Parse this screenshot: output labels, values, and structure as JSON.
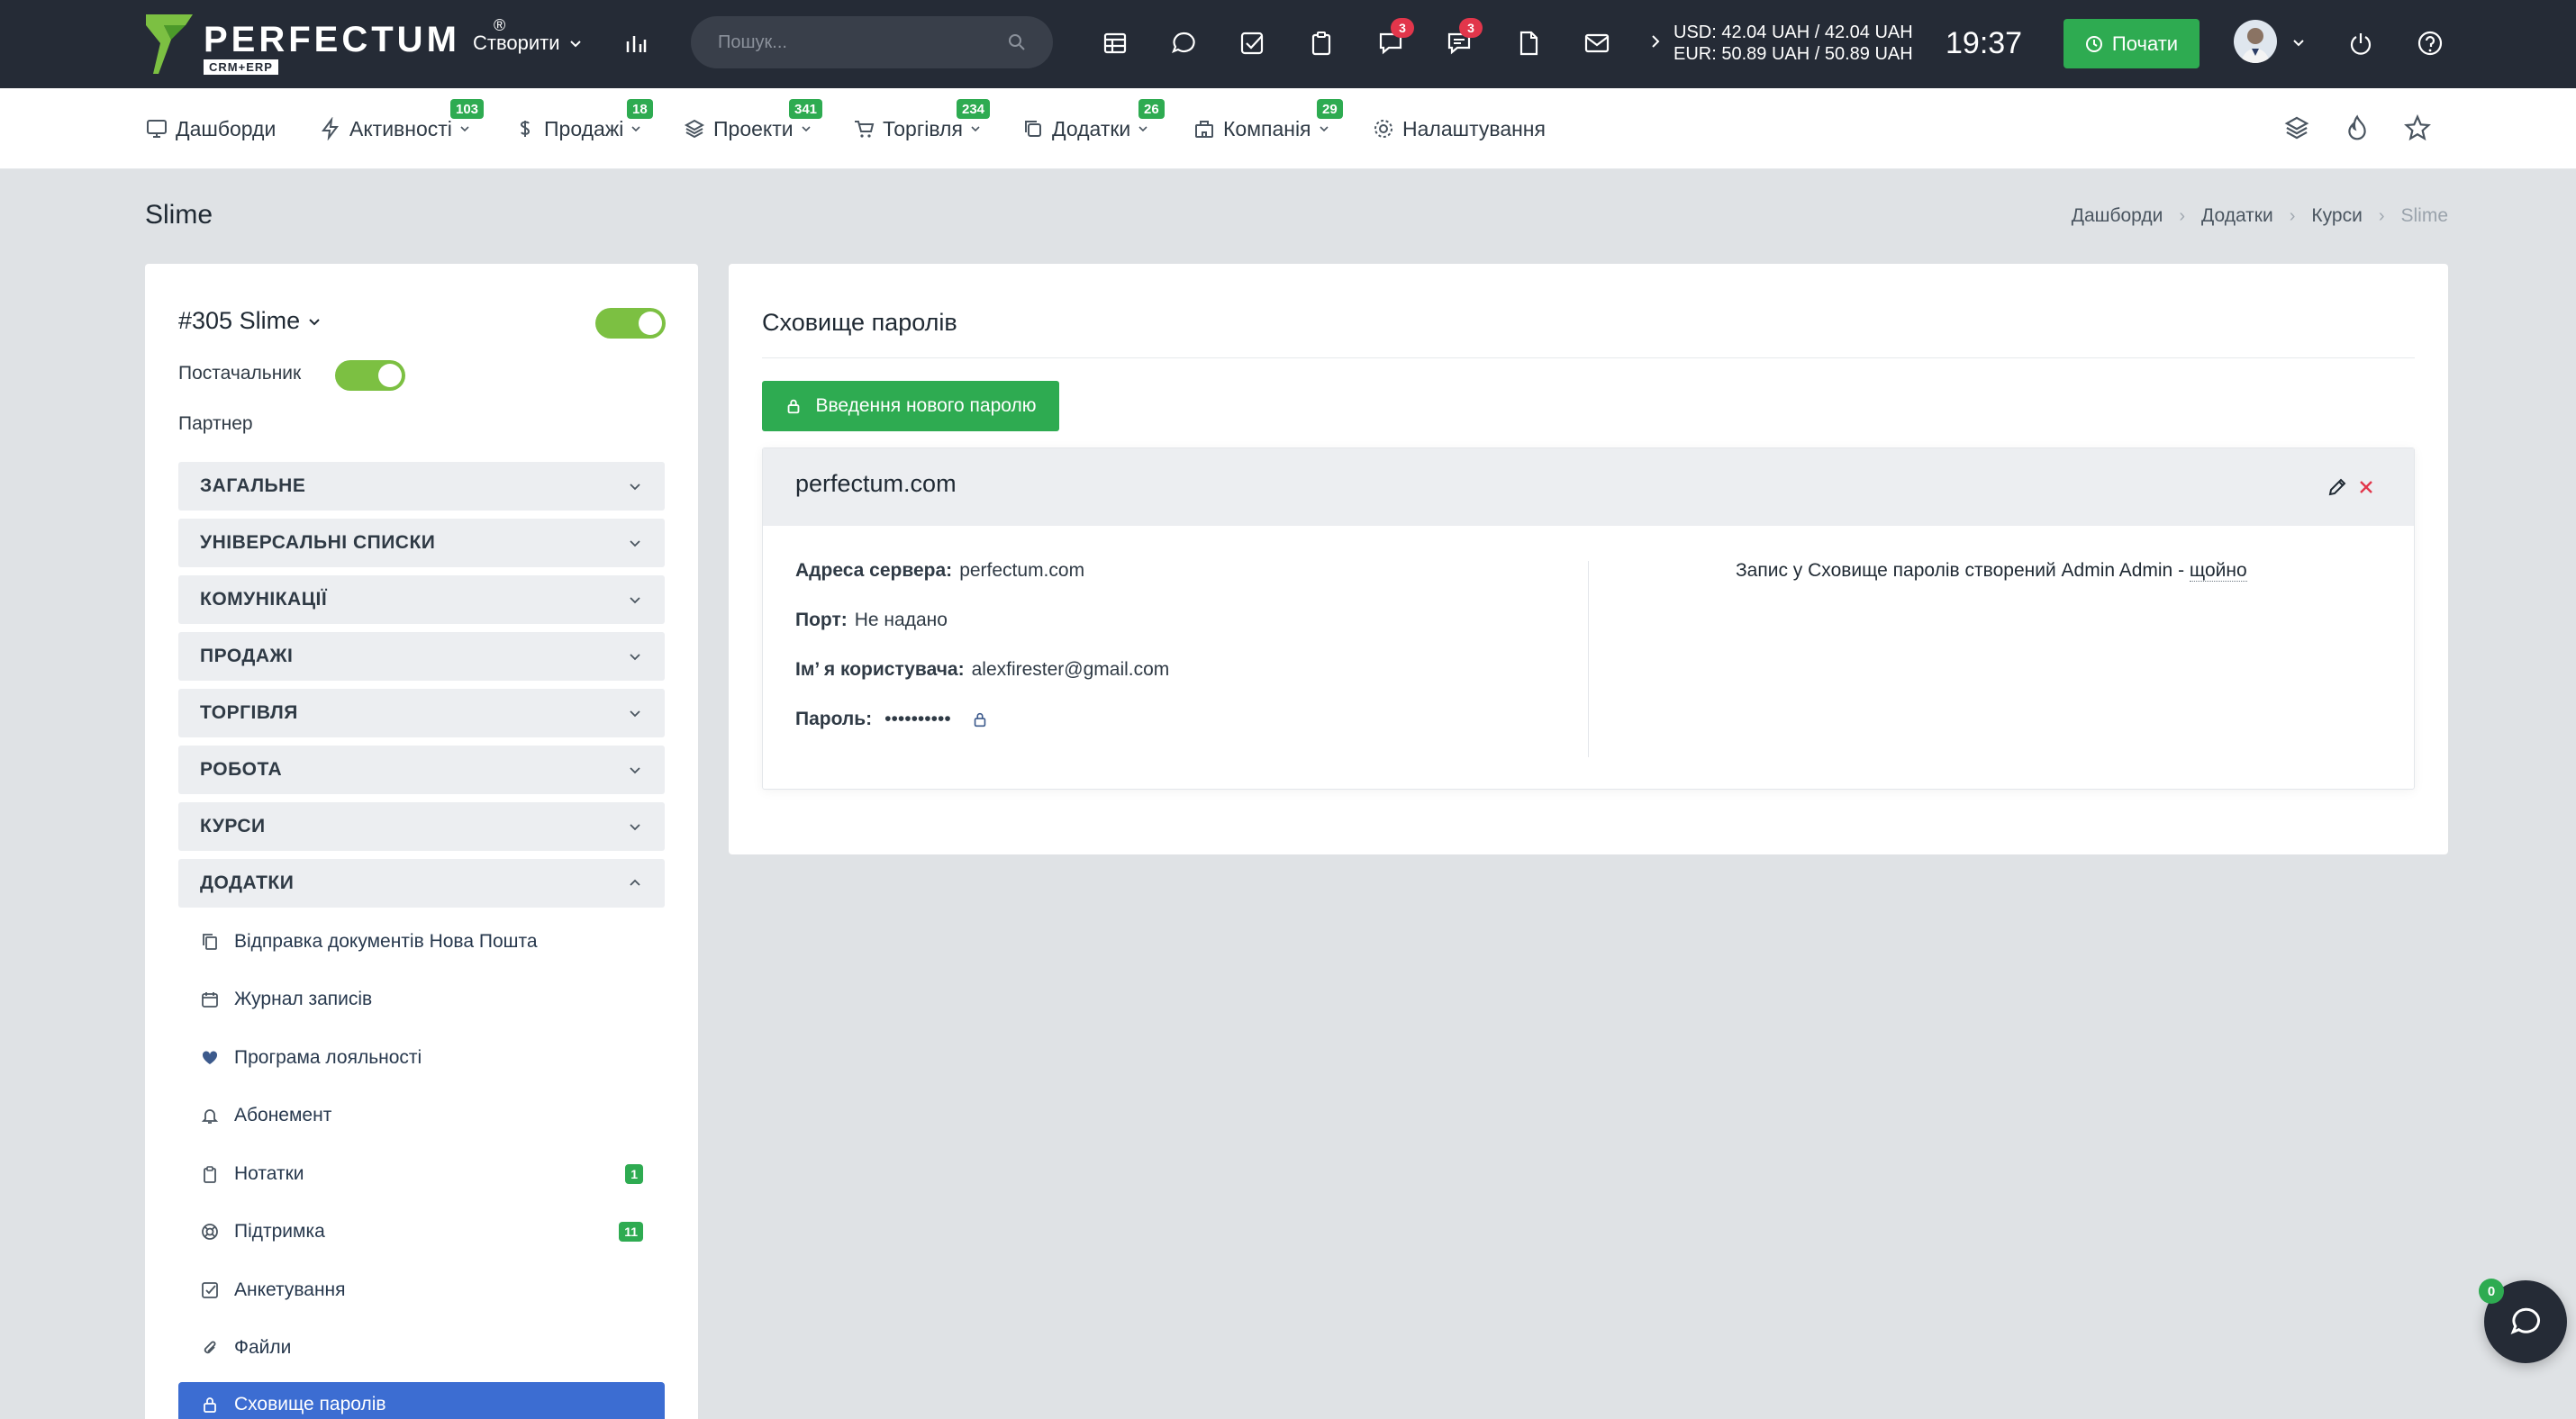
{
  "brand": {
    "name": "PERFECTUM",
    "reg": "®",
    "sub": "CRM+ERP"
  },
  "topbar": {
    "create_label": "Створити",
    "search_placeholder": "Пошук...",
    "badges": {
      "messages": "3",
      "chat": "3"
    },
    "rates": {
      "usd": "USD: 42.04 UAH / 42.04 UAH",
      "eur": "EUR: 50.89 UAH / 50.89 UAH"
    },
    "time": "19:37",
    "start_label": "Почати"
  },
  "modnav": [
    {
      "label": "Дашборди",
      "icon": "monitor-icon",
      "badge": ""
    },
    {
      "label": "Активності",
      "icon": "bolt-icon",
      "badge": "103"
    },
    {
      "label": "Продажі",
      "icon": "dollar-icon",
      "badge": "18"
    },
    {
      "label": "Проекти",
      "icon": "layers-icon",
      "badge": "341"
    },
    {
      "label": "Торгівля",
      "icon": "cart-icon",
      "badge": "234"
    },
    {
      "label": "Додатки",
      "icon": "copy-icon",
      "badge": "26"
    },
    {
      "label": "Компанія",
      "icon": "building-icon",
      "badge": "29"
    },
    {
      "label": "Налаштування",
      "icon": "gear-icon",
      "badge": ""
    }
  ],
  "page": {
    "title": "Slime",
    "breadcrumb": [
      "Дашборди",
      "Додатки",
      "Курси",
      "Slime"
    ]
  },
  "sidebar": {
    "record_title": "#305 Slime",
    "supplier_label": "Постачальник",
    "partner_label": "Партнер",
    "sections": [
      "ЗАГАЛЬНЕ",
      "УНІВЕРСАЛЬНІ СПИСКИ",
      "КОМУНІКАЦІЇ",
      "ПРОДАЖІ",
      "ТОРГІВЛЯ",
      "РОБОТА",
      "КУРСИ",
      "ДОДАТКИ"
    ],
    "addons": [
      {
        "label": "Відправка документів Нова Пошта",
        "icon": "documents-icon",
        "badge": ""
      },
      {
        "label": "Журнал записів",
        "icon": "calendar-icon",
        "badge": ""
      },
      {
        "label": "Програма лояльності",
        "icon": "heart-icon",
        "badge": ""
      },
      {
        "label": "Абонемент",
        "icon": "bell-icon",
        "badge": ""
      },
      {
        "label": "Нотатки",
        "icon": "clipboard-icon",
        "badge": "1"
      },
      {
        "label": "Підтримка",
        "icon": "lifebuoy-icon",
        "badge": "11"
      },
      {
        "label": "Анкетування",
        "icon": "checkbox-icon",
        "badge": ""
      },
      {
        "label": "Файли",
        "icon": "paperclip-icon",
        "badge": ""
      },
      {
        "label": "Сховище паролів",
        "icon": "lock-icon",
        "badge": ""
      }
    ]
  },
  "vault": {
    "title": "Сховище паролів",
    "add_button": "Введення нового паролю",
    "entry": {
      "name": "perfectum.com",
      "server_label": "Адреса сервера:",
      "server_value": "perfectum.com",
      "port_label": "Порт:",
      "port_value": "Не надано",
      "user_label": "Ім’ я користувача:",
      "user_value": "alexfirester@gmail.com",
      "password_label": "Пароль:",
      "password_value": "••••••••••",
      "log_text": "Запис у Сховище паролів створений Admin Admin - ",
      "log_when": "щойно"
    }
  },
  "chat": {
    "badge": "0"
  },
  "colors": {
    "topbar": "#252b36",
    "green": "#2eab51",
    "active_blue": "#3c6dd2",
    "badge_red": "#e2364b",
    "toggle_green": "#7cc042"
  }
}
